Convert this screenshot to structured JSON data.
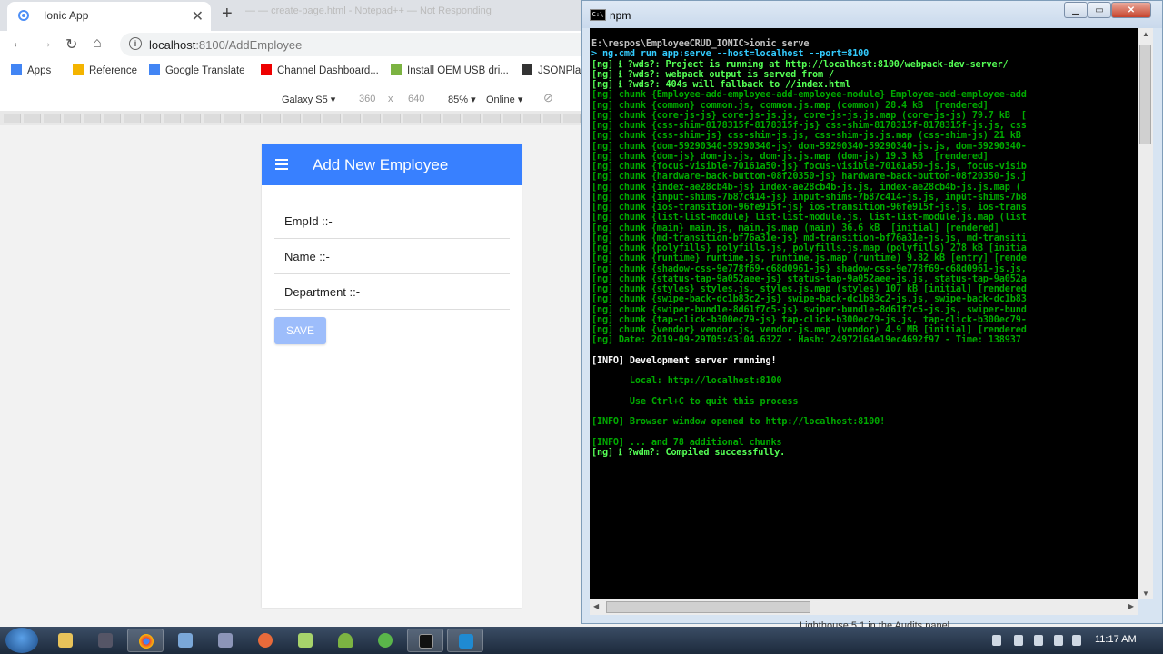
{
  "browser": {
    "tab_title": "Ionic App",
    "background_title": "— — create-page.html - Notepad++ — Not Responding",
    "url_host": "localhost",
    "url_path": ":8100/AddEmployee",
    "bookmarks": [
      {
        "label": "Apps",
        "color": "#4285f4"
      },
      {
        "label": "Reference",
        "color": "#f4b400"
      },
      {
        "label": "Google Translate",
        "color": "#4285f4"
      },
      {
        "label": "Channel Dashboard...",
        "color": "#e00"
      },
      {
        "label": "Install OEM USB dri...",
        "color": "#7cb342"
      },
      {
        "label": "JSONPla",
        "color": "#333333"
      }
    ],
    "device_toolbar": {
      "device": "Galaxy S5",
      "width": "360",
      "x_sep": "x",
      "height": "640",
      "zoom": "85%",
      "network": "Online"
    }
  },
  "app": {
    "title": "Add New Employee",
    "fields": [
      "EmpId ::-",
      "Name ::-",
      "Department ::-"
    ],
    "save_label": "SAVE",
    "primary_color": "#3880ff"
  },
  "terminal": {
    "title": "npm",
    "lines": [
      {
        "t": "E:\\respos\\EmployeeCRUD_IONIC>ionic serve",
        "c": "#c0c0c0"
      },
      {
        "t": "> ng.cmd run app:serve --host=localhost --port=8100",
        "c": "#33ccff"
      },
      {
        "t": "[ng] ℹ ?wds?: Project is running at http://localhost:8100/webpack-dev-server/",
        "c": "#55ff55"
      },
      {
        "t": "[ng] ℹ ?wds?: webpack output is served from /",
        "c": "#55ff55"
      },
      {
        "t": "[ng] ℹ ?wds?: 404s will fallback to //index.html",
        "c": "#55ff55"
      },
      {
        "t": "[ng] chunk {Employee-add-employee-add-employee-module} Employee-add-employee-add",
        "c": "#00aa00"
      },
      {
        "t": "[ng] chunk {common} common.js, common.js.map (common) 28.4 kB  [rendered]",
        "c": "#00aa00"
      },
      {
        "t": "[ng] chunk {core-js-js} core-js-js.js, core-js-js.js.map (core-js-js) 79.7 kB  [",
        "c": "#00aa00"
      },
      {
        "t": "[ng] chunk {css-shim-8178315f-8178315f-js} css-shim-8178315f-8178315f-js.js, css",
        "c": "#00aa00"
      },
      {
        "t": "[ng] chunk {css-shim-js} css-shim-js.js, css-shim-js.js.map (css-shim-js) 21 kB",
        "c": "#00aa00"
      },
      {
        "t": "[ng] chunk {dom-59290340-59290340-js} dom-59290340-59290340-js.js, dom-59290340-",
        "c": "#00aa00"
      },
      {
        "t": "[ng] chunk {dom-js} dom-js.js, dom-js.js.map (dom-js) 19.3 kB  [rendered]",
        "c": "#00aa00"
      },
      {
        "t": "[ng] chunk {focus-visible-70161a50-js} focus-visible-70161a50-js.js, focus-visib",
        "c": "#00aa00"
      },
      {
        "t": "[ng] chunk {hardware-back-button-08f20350-js} hardware-back-button-08f20350-js.j",
        "c": "#00aa00"
      },
      {
        "t": "[ng] chunk {index-ae28cb4b-js} index-ae28cb4b-js.js, index-ae28cb4b-js.js.map (",
        "c": "#00aa00"
      },
      {
        "t": "[ng] chunk {input-shims-7b87c414-js} input-shims-7b87c414-js.js, input-shims-7b8",
        "c": "#00aa00"
      },
      {
        "t": "[ng] chunk {ios-transition-96fe915f-js} ios-transition-96fe915f-js.js, ios-trans",
        "c": "#00aa00"
      },
      {
        "t": "[ng] chunk {list-list-module} list-list-module.js, list-list-module.js.map (list",
        "c": "#00aa00"
      },
      {
        "t": "[ng] chunk {main} main.js, main.js.map (main) 36.6 kB  [initial] [rendered]",
        "c": "#00aa00"
      },
      {
        "t": "[ng] chunk {md-transition-bf76a31e-js} md-transition-bf76a31e-js.js, md-transiti",
        "c": "#00aa00"
      },
      {
        "t": "[ng] chunk {polyfills} polyfills.js, polyfills.js.map (polyfills) 278 kB [initia",
        "c": "#00aa00"
      },
      {
        "t": "[ng] chunk {runtime} runtime.js, runtime.js.map (runtime) 9.82 kB [entry] [rende",
        "c": "#00aa00"
      },
      {
        "t": "[ng] chunk {shadow-css-9e778f69-c68d0961-js} shadow-css-9e778f69-c68d0961-js.js,",
        "c": "#00aa00"
      },
      {
        "t": "[ng] chunk {status-tap-9a052aee-js} status-tap-9a052aee-js.js, status-tap-9a052a",
        "c": "#00aa00"
      },
      {
        "t": "[ng] chunk {styles} styles.js, styles.js.map (styles) 107 kB [initial] [rendered",
        "c": "#00aa00"
      },
      {
        "t": "[ng] chunk {swipe-back-dc1b83c2-js} swipe-back-dc1b83c2-js.js, swipe-back-dc1b83",
        "c": "#00aa00"
      },
      {
        "t": "[ng] chunk {swiper-bundle-8d61f7c5-js} swiper-bundle-8d61f7c5-js.js, swiper-bund",
        "c": "#00aa00"
      },
      {
        "t": "[ng] chunk {tap-click-b300ec79-js} tap-click-b300ec79-js.js, tap-click-b300ec79-",
        "c": "#00aa00"
      },
      {
        "t": "[ng] chunk {vendor} vendor.js, vendor.js.map (vendor) 4.9 MB [initial] [rendered",
        "c": "#00aa00"
      },
      {
        "t": "[ng] Date: 2019-09-29T05:43:04.632Z - Hash: 24972164e19ec4692f97 - Time: 138937",
        "c": "#00aa00"
      },
      {
        "t": "",
        "c": "#00aa00"
      },
      {
        "t": "[INFO] Development server running!",
        "c": "#ffffff"
      },
      {
        "t": "",
        "c": "#00aa00"
      },
      {
        "t": "       Local: http://localhost:8100",
        "c": "#00aa00"
      },
      {
        "t": "",
        "c": "#00aa00"
      },
      {
        "t": "       Use Ctrl+C to quit this process",
        "c": "#00aa00"
      },
      {
        "t": "",
        "c": "#00aa00"
      },
      {
        "t": "[INFO] Browser window opened to http://localhost:8100!",
        "c": "#00aa00"
      },
      {
        "t": "",
        "c": "#00aa00"
      },
      {
        "t": "[INFO] ... and 78 additional chunks",
        "c": "#00aa00"
      },
      {
        "t": "[ng] ℹ ?wdm?: Compiled successfully.",
        "c": "#55ff55"
      }
    ]
  },
  "behind_window_text": "Lighthouse 5.1 in the Audits panel",
  "taskbar": {
    "clock": "11:17 AM"
  }
}
